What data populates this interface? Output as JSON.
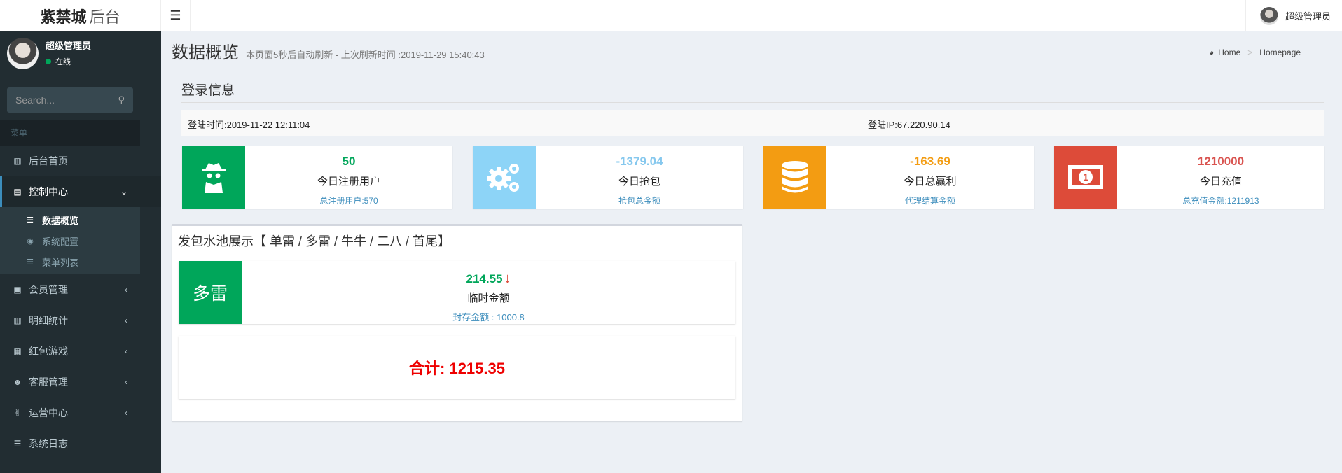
{
  "header": {
    "logo_bold": "紫禁城",
    "logo_light": "后台",
    "toggle_icon": "hamburger-icon",
    "user": "超级管理员"
  },
  "sidebar": {
    "user_name": "超级管理员",
    "status": "在线",
    "search_placeholder": "Search...",
    "menu_header": "菜单",
    "items": [
      {
        "label": "后台首页",
        "icon": "bar-chart-icon"
      },
      {
        "label": "控制中心",
        "icon": "list-icon",
        "active": true,
        "expanded": true
      },
      {
        "label": "会员管理",
        "icon": "user-card-icon"
      },
      {
        "label": "明细统计",
        "icon": "bar-chart-icon"
      },
      {
        "label": "红包游戏",
        "icon": "expand-icon"
      },
      {
        "label": "客服管理",
        "icon": "users-icon"
      },
      {
        "label": "运营中心",
        "icon": "hand-icon"
      },
      {
        "label": "系统日志",
        "icon": "database-icon"
      }
    ],
    "submenu": [
      {
        "label": "数据概览",
        "icon": "list-icon",
        "active": true
      },
      {
        "label": "系统配置",
        "icon": "toggle-icon"
      },
      {
        "label": "菜单列表",
        "icon": "list-icon"
      }
    ]
  },
  "content": {
    "title": "数据概览",
    "subtitle": "本页面5秒后自动刷新 - 上次刷新时间 :2019-11-29 15:40:43",
    "breadcrumb": [
      "Home",
      "Homepage"
    ],
    "section_title": "登录信息",
    "login_time": "登陆时间:2019-11-22 12:11:04",
    "login_ip": "登陆IP:67.220.90.14"
  },
  "stats": [
    {
      "value": "50",
      "label": "今日注册用户",
      "footer": "总注册用户:570",
      "color": "#00a65a",
      "value_color": "#00a65a",
      "icon": "spy-icon"
    },
    {
      "value": "-1379.04",
      "label": "今日抢包",
      "footer": "抢包总金额",
      "color": "#8dd4f7",
      "value_color": "#86c8ee",
      "icon": "gears-icon"
    },
    {
      "value": "-163.69",
      "label": "今日总赢利",
      "footer": "代理结算金额",
      "color": "#f39c12",
      "value_color": "#f39c12",
      "icon": "database-icon"
    },
    {
      "value": "1210000",
      "label": "今日充值",
      "footer": "总充值金额:1211913",
      "color": "#dd4b39",
      "value_color": "#d9534f",
      "icon": "money-icon"
    }
  ],
  "pool": {
    "title": "发包水池展示【 单雷 / 多雷 / 牛牛 / 二八 / 首尾】",
    "tag": "多雷",
    "value": "214.55",
    "arrow": "↓",
    "label": "临时金额",
    "footer": "封存金额 : 1000.8",
    "total": "合计:  1215.35"
  }
}
